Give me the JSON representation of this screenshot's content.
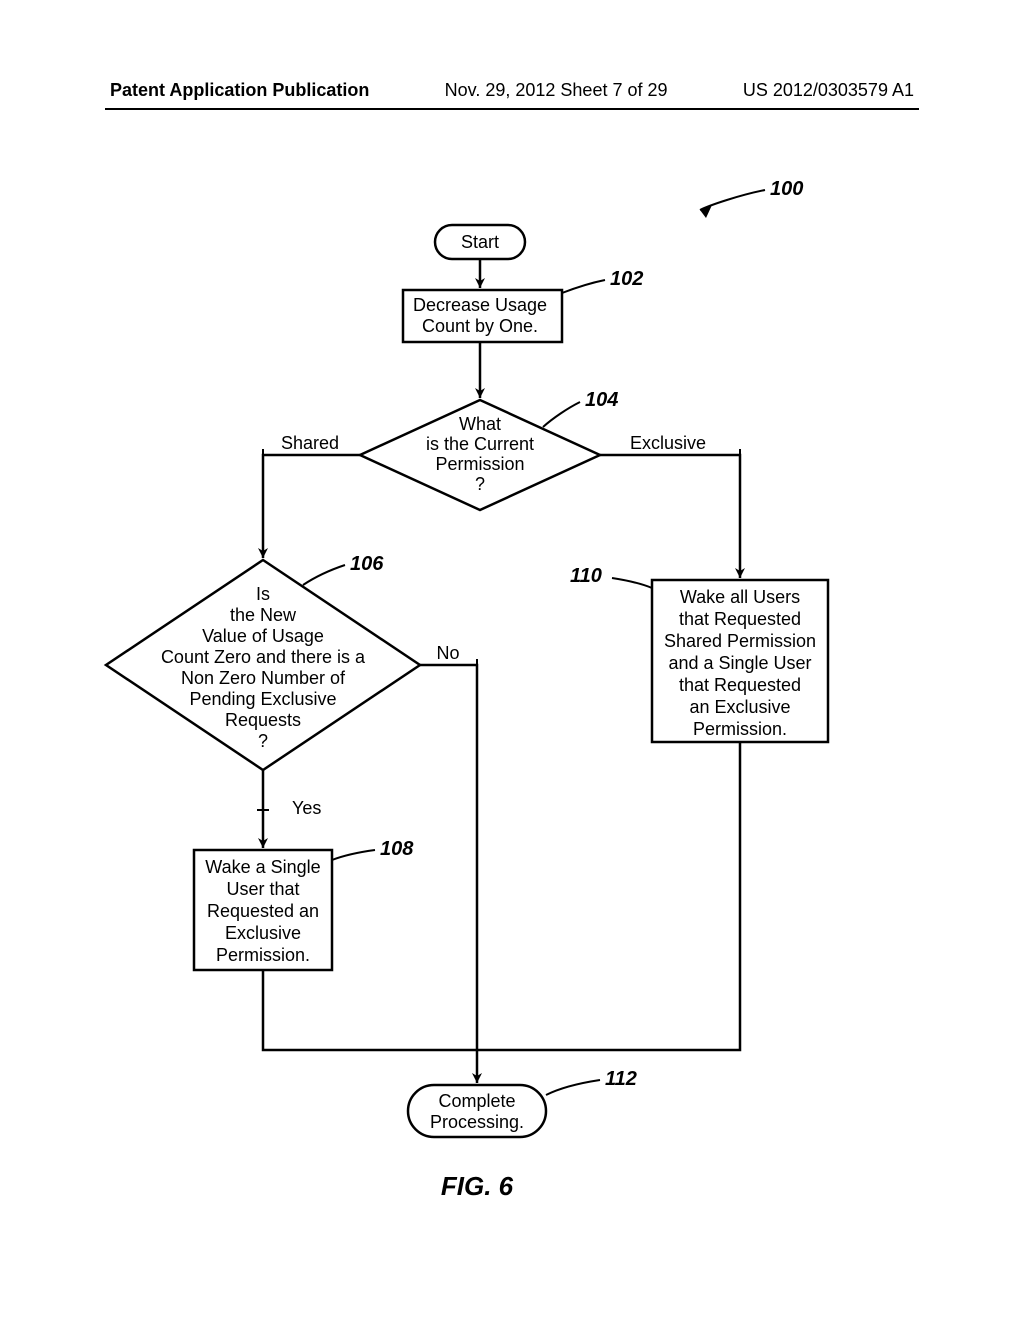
{
  "header": {
    "left": "Patent Application Publication",
    "center": "Nov. 29, 2012  Sheet 7 of 29",
    "right": "US 2012/0303579 A1"
  },
  "refs": {
    "r100": "100",
    "r102": "102",
    "r104": "104",
    "r106": "106",
    "r108": "108",
    "r110": "110",
    "r112": "112"
  },
  "nodes": {
    "start": "Start",
    "box102_l1": "Decrease Usage",
    "box102_l2": "Count by One.",
    "d104_l1": "What",
    "d104_l2": "is the Current",
    "d104_l3": "Permission",
    "d104_l4": "?",
    "d106_l1": "Is",
    "d106_l2": "the New",
    "d106_l3": "Value of Usage",
    "d106_l4": "Count Zero and there is a",
    "d106_l5": "Non Zero Number of",
    "d106_l6": "Pending Exclusive",
    "d106_l7": "Requests",
    "d106_l8": "?",
    "box108_l1": "Wake a Single",
    "box108_l2": "User that",
    "box108_l3": "Requested an",
    "box108_l4": "Exclusive",
    "box108_l5": "Permission.",
    "box110_l1": "Wake all Users",
    "box110_l2": "that Requested",
    "box110_l3": "Shared Permission",
    "box110_l4": "and a Single User",
    "box110_l5": "that Requested",
    "box110_l6": "an Exclusive",
    "box110_l7": "Permission.",
    "end_l1": "Complete",
    "end_l2": "Processing."
  },
  "edges": {
    "shared": "Shared",
    "exclusive": "Exclusive",
    "yes": "Yes",
    "no": "No"
  },
  "figure": "FIG.  6"
}
